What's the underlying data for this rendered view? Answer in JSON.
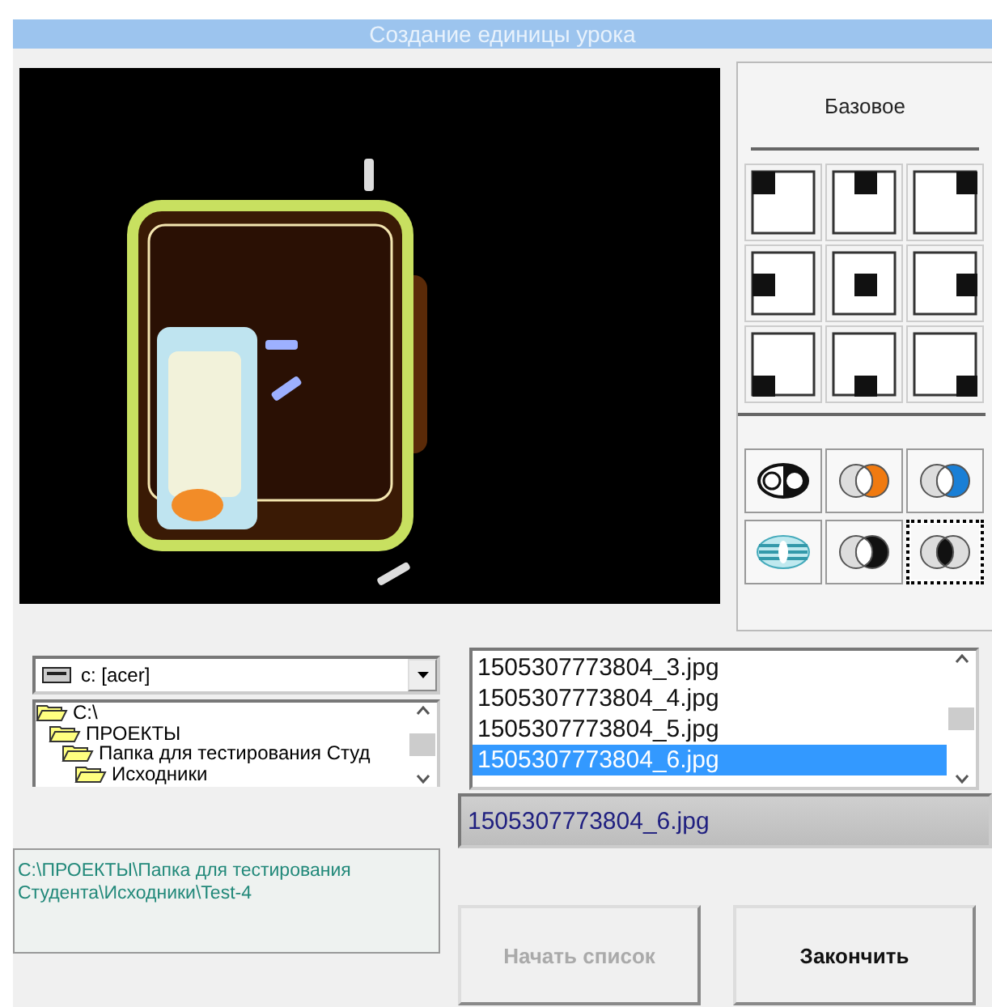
{
  "window": {
    "title": "Создание единицы урока"
  },
  "base_button": {
    "label": "Базовое"
  },
  "positions": [
    {
      "kind": "top-left",
      "selected": false
    },
    {
      "kind": "top",
      "selected": false
    },
    {
      "kind": "top-right",
      "selected": false
    },
    {
      "kind": "left",
      "selected": false
    },
    {
      "kind": "center",
      "selected": false
    },
    {
      "kind": "right",
      "selected": false
    },
    {
      "kind": "bottom-left",
      "selected": false
    },
    {
      "kind": "bottom",
      "selected": false
    },
    {
      "kind": "bottom-right",
      "selected": false
    }
  ],
  "blend_modes": [
    {
      "kind": "sen",
      "selected": false
    },
    {
      "kind": "orange",
      "selected": false
    },
    {
      "kind": "blue",
      "selected": false
    },
    {
      "kind": "striped",
      "selected": false
    },
    {
      "kind": "dark",
      "selected": false
    },
    {
      "kind": "dark-center",
      "selected": true
    }
  ],
  "drive": {
    "value": "c: [acer]"
  },
  "folders": [
    {
      "label": "C:\\",
      "children": [
        {
          "label": "ПРОЕКТЫ",
          "children": [
            {
              "label": "Папка для тестирования Студ",
              "children": [
                {
                  "label": "Исходники"
                }
              ]
            }
          ]
        }
      ]
    }
  ],
  "path": "C:\\ПРОЕКТЫ\\Папка для тестирования Студента\\Исходники\\Test-4",
  "files": [
    {
      "name": "1505307773804_3.jpg",
      "selected": false
    },
    {
      "name": "1505307773804_4.jpg",
      "selected": false
    },
    {
      "name": "1505307773804_5.jpg",
      "selected": false
    },
    {
      "name": "1505307773804_6.jpg",
      "selected": true
    }
  ],
  "selected_file": "1505307773804_6.jpg",
  "buttons": [
    {
      "label": "Начать список",
      "disabled": true
    },
    {
      "label": "Закончить",
      "disabled": false
    }
  ]
}
